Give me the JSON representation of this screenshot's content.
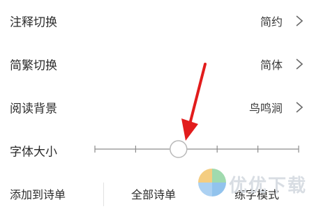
{
  "settings": {
    "rows": [
      {
        "label": "注释切换",
        "value": "简约"
      },
      {
        "label": "简繁切换",
        "value": "简体"
      },
      {
        "label": "阅读背景",
        "value": "鸟鸣涧"
      }
    ],
    "font_size": {
      "label": "字体大小",
      "ticks": 6,
      "selected_index": 2
    }
  },
  "bottom": {
    "add_to_list": "添加到诗单",
    "all_lists": "全部诗单",
    "practice_mode": "练字模式"
  },
  "icons": {
    "chevron": "chevron-right-icon",
    "annotation_arrow": "red-arrow-icon",
    "watermark_logo": "site-logo-icon"
  },
  "colors": {
    "text": "#2b2b2b",
    "arrow": "#e21c1c",
    "slider_track": "#8c8c8c",
    "slider_thumb_border": "#b9b9b9"
  },
  "watermark": {
    "text": "优优下载"
  }
}
